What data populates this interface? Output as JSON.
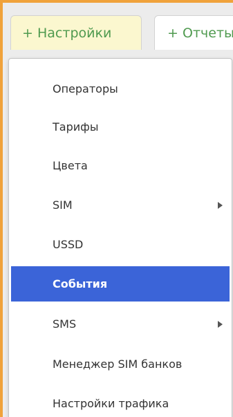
{
  "tabs": {
    "settings": {
      "icon": "plus-icon",
      "plus": "+",
      "label": "Настройки"
    },
    "reports": {
      "icon": "plus-icon",
      "plus": "+",
      "label": "Отчеты"
    }
  },
  "colors": {
    "accent_orange": "#f0a23b",
    "selected_bg": "#3b64d8",
    "tab_active_bg": "#fbf7cf",
    "tab_text": "#4f9a4f"
  },
  "menu": {
    "items": [
      {
        "label": "Операторы",
        "has_submenu": false,
        "selected": false
      },
      {
        "label": "Тарифы",
        "has_submenu": false,
        "selected": false
      },
      {
        "label": "Цвета",
        "has_submenu": false,
        "selected": false
      },
      {
        "label": "SIM",
        "has_submenu": true,
        "selected": false
      },
      {
        "label": "USSD",
        "has_submenu": false,
        "selected": false
      },
      {
        "label": "События",
        "has_submenu": false,
        "selected": true
      },
      {
        "label": "SMS",
        "has_submenu": true,
        "selected": false
      },
      {
        "label": "Менеджер SIM банков",
        "has_submenu": false,
        "selected": false
      },
      {
        "label": "Настройки трафика",
        "has_submenu": false,
        "selected": false
      }
    ]
  }
}
